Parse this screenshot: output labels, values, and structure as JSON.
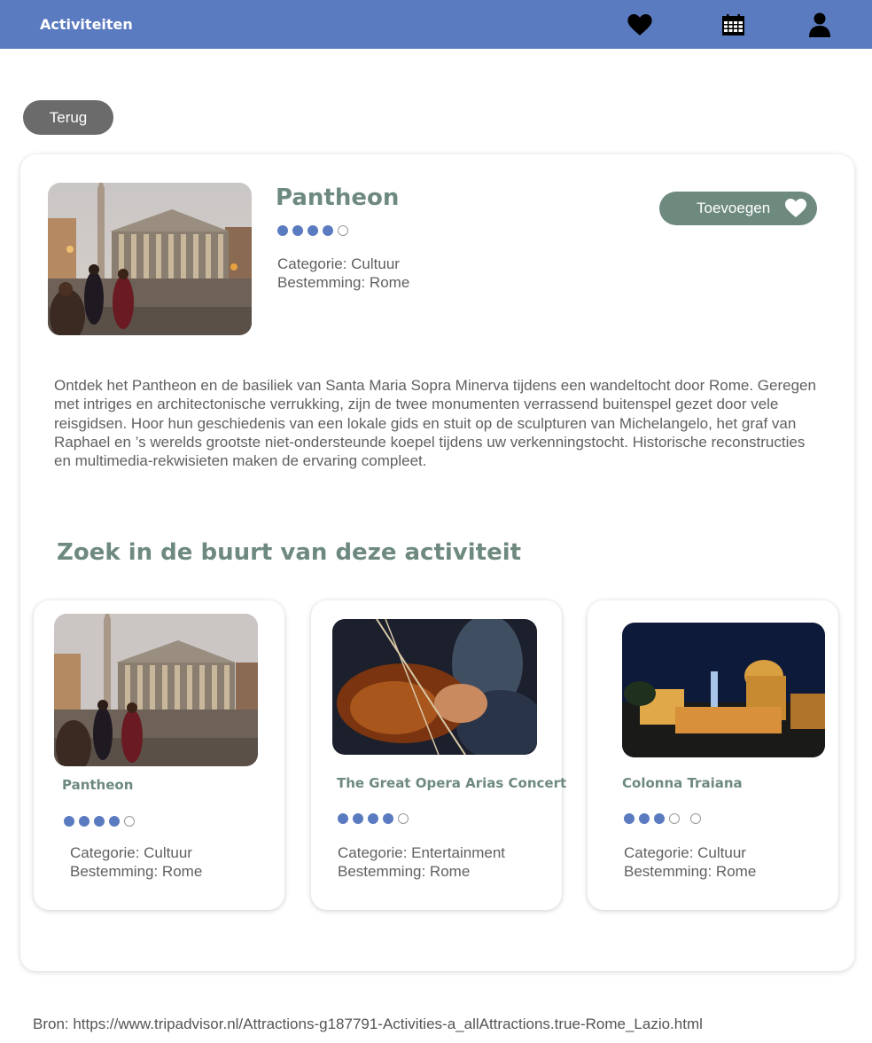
{
  "header": {
    "app_title": "Activiteiten",
    "icons": [
      "heart-icon",
      "calendar-icon",
      "user-icon"
    ]
  },
  "back_label": "Terug",
  "detail": {
    "title": "Pantheon",
    "rating": 4,
    "rating_max": 5,
    "category": "Categorie: Cultuur",
    "destination": "Bestemming: Rome",
    "add_label": "Toevoegen",
    "description": "Ontdek het Pantheon en de basiliek van Santa Maria Sopra Minerva tijdens een wandeltocht door Rome. Geregen met intriges en architectonische verrukking, zijn de twee monumenten verrassend buitenspel gezet door vele reisgidsen. Hoor hun geschiedenis van een lokale gids en stuit op de sculpturen van Michelangelo, het graf van Raphael en ’s werelds grootste niet-ondersteunde koepel tijdens uw verkenningstocht. Historische reconstructies en multimedia-rekwisieten maken de ervaring compleet."
  },
  "nearby": {
    "title": "Zoek in de buurt van deze activiteit",
    "cards": [
      {
        "title": "Pantheon",
        "rating": 4,
        "category": "Categorie: Cultuur",
        "destination": "Bestemming: Rome"
      },
      {
        "title": "The Great Opera Arias Concert",
        "rating": 4,
        "category": "Categorie: Entertainment",
        "destination": "Bestemming: Rome"
      },
      {
        "title": "Colonna Traiana",
        "rating": 3,
        "category": "Categorie: Cultuur",
        "destination": "Bestemming: Rome"
      }
    ]
  },
  "source": "Bron: https://www.tripadvisor.nl/Attractions-g187791-Activities-a_allAttractions.true-Rome_Lazio.html",
  "colors": {
    "header": "#5b7bc0",
    "accent_green": "#6e8a7f",
    "back_button": "#6b6b6b",
    "rating_dot": "#5b7bc0"
  }
}
